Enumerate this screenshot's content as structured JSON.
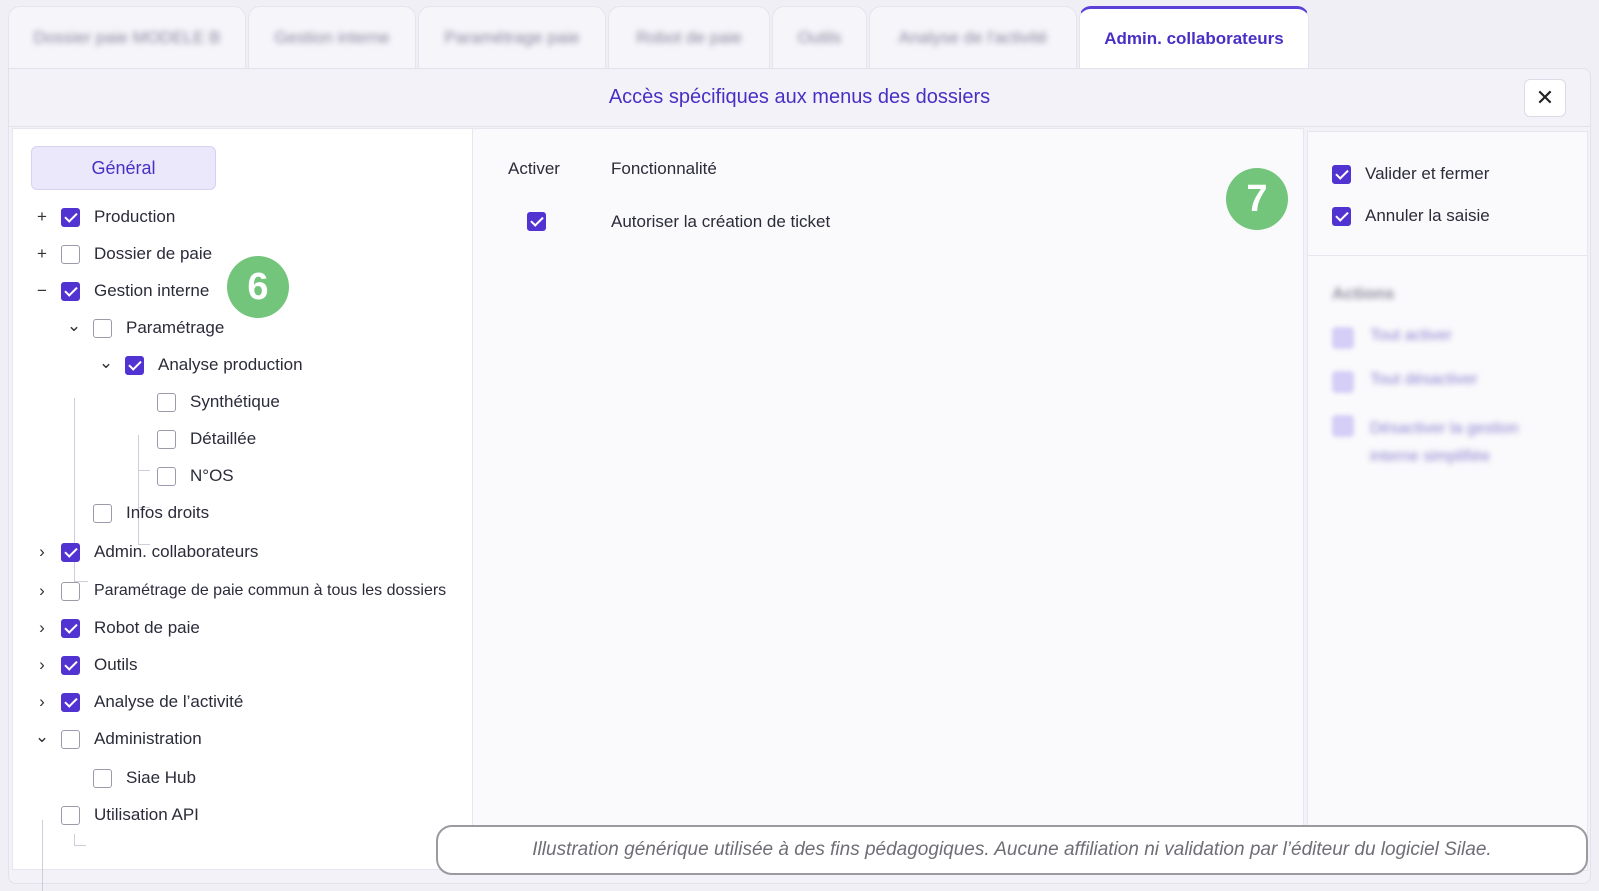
{
  "tabs": [
    {
      "label": "Dossier paie MODELE B",
      "blurred": true,
      "width": 238
    },
    {
      "label": "Gestion interne",
      "blurred": true,
      "width": 168
    },
    {
      "label": "Paramétrage paie",
      "blurred": true,
      "width": 188
    },
    {
      "label": "Robot de paie",
      "blurred": true,
      "width": 162
    },
    {
      "label": "Outils",
      "blurred": true,
      "width": 95
    },
    {
      "label": "Analyse de l'activité",
      "blurred": true,
      "width": 208
    },
    {
      "label": "Admin. collaborateurs",
      "blurred": false,
      "active": true,
      "width": 230
    }
  ],
  "panel": {
    "title": "Accès spécifiques aux menus des dossiers",
    "close_label": "✕"
  },
  "left": {
    "general_label": "Général",
    "tree": [
      {
        "label": "Production",
        "checked": true,
        "toggle": "+",
        "level": 0
      },
      {
        "label": "Dossier de paie",
        "checked": false,
        "toggle": "+",
        "level": 0
      },
      {
        "label": "Gestion interne",
        "checked": true,
        "toggle": "−",
        "level": 0
      },
      {
        "label": "Paramétrage",
        "checked": false,
        "toggle": "⌄",
        "level": 1
      },
      {
        "label": "Analyse production",
        "checked": true,
        "toggle": "⌄",
        "level": 2
      },
      {
        "label": "Synthétique",
        "checked": false,
        "toggle": "",
        "level": 3
      },
      {
        "label": "Détaillée",
        "checked": false,
        "toggle": "",
        "level": 3
      },
      {
        "label": "N°OS",
        "checked": false,
        "toggle": "",
        "level": 3
      },
      {
        "label": "Infos droits",
        "checked": false,
        "toggle": "",
        "level": 1
      },
      {
        "label": "Admin. collaborateurs",
        "checked": true,
        "toggle": "›",
        "level": 0
      },
      {
        "label": "Paramétrage de paie commun à tous les dossiers",
        "checked": false,
        "toggle": "›",
        "level": 0
      },
      {
        "label": "Robot de paie",
        "checked": true,
        "toggle": "›",
        "level": 0
      },
      {
        "label": "Outils",
        "checked": true,
        "toggle": "›",
        "level": 0
      },
      {
        "label": "Analyse de l’activité",
        "checked": true,
        "toggle": "›",
        "level": 0
      },
      {
        "label": "Administration",
        "checked": false,
        "toggle": "⌄",
        "level": 0
      },
      {
        "label": "Siae Hub",
        "checked": false,
        "toggle": "",
        "level": 1
      },
      {
        "label": "Utilisation API",
        "checked": false,
        "toggle": "",
        "level": 0
      }
    ]
  },
  "middle": {
    "col_activer": "Activer",
    "col_fonctionnalite": "Fonctionnalité",
    "rows": [
      {
        "checked": true,
        "label": "Autoriser la création de ticket"
      }
    ]
  },
  "right": {
    "options": [
      {
        "label": "Valider et fermer",
        "checked": true
      },
      {
        "label": "Annuler la saisie",
        "checked": true
      }
    ],
    "actions_title": "Actions",
    "actions": [
      "Tout activer",
      "Tout désactiver",
      "Désactiver la gestion interne simplifiée"
    ]
  },
  "badges": {
    "six": "6",
    "seven": "7"
  },
  "disclaimer": "Illustration générique utilisée à des fins pédagogiques. Aucune affiliation ni validation par l’éditeur du logiciel Silae.",
  "colors": {
    "accent": "#5133d1",
    "badge": "#72c57a"
  }
}
